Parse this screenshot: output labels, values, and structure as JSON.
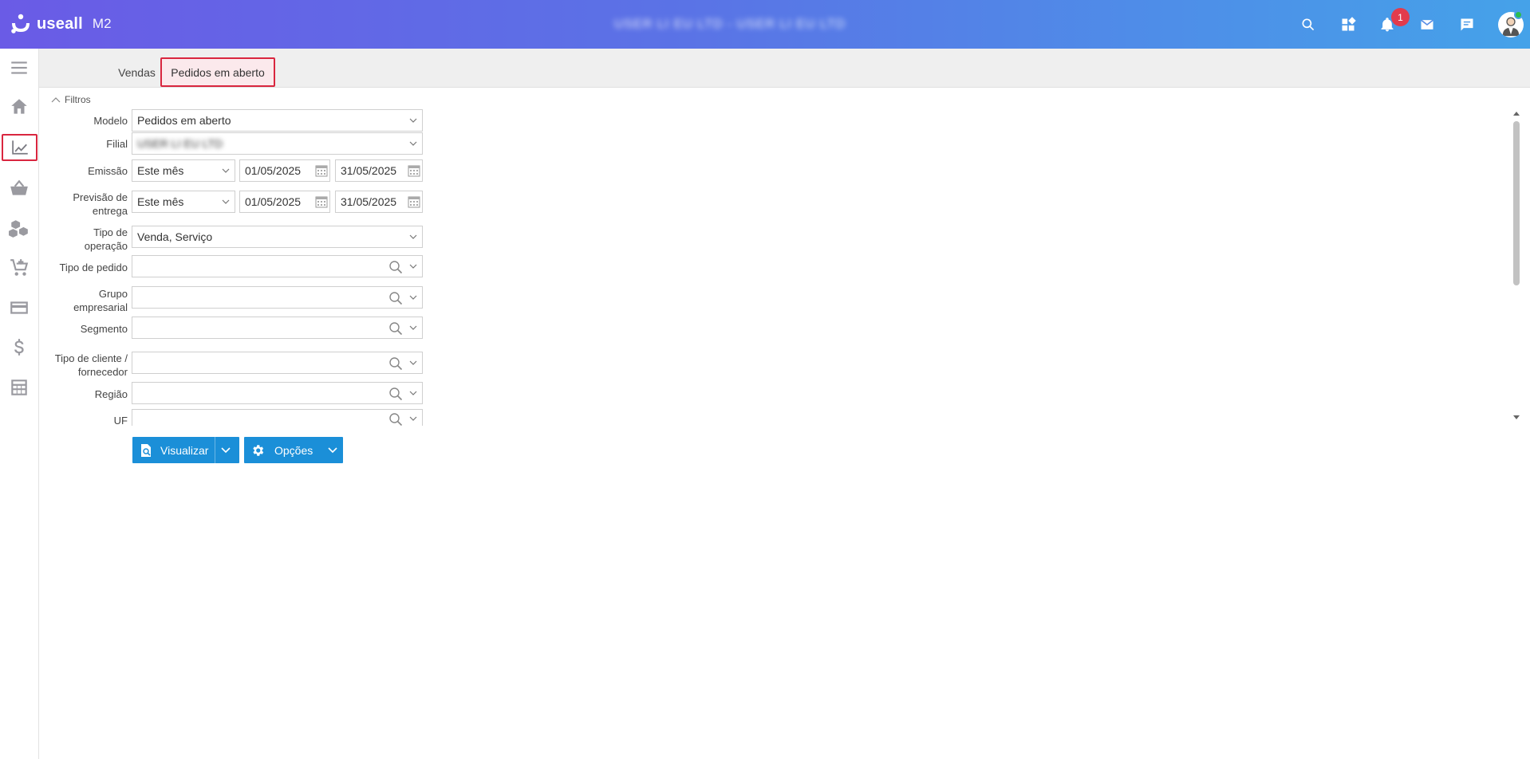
{
  "header": {
    "brand": "useall",
    "version": "M2",
    "company": "USER LI EU LTD - USER LI EU LTD",
    "notification_count": "1"
  },
  "header_icons": [
    "search-icon",
    "dashboard-icon",
    "bell-icon",
    "mail-icon",
    "chat-icon",
    "user-avatar"
  ],
  "sidebar": {
    "items": [
      "menu-icon",
      "home-icon",
      "chart-icon",
      "basket-icon",
      "boxes-icon",
      "cart-icon",
      "card-icon",
      "dollar-icon",
      "calculator-icon"
    ],
    "active": "chart-icon"
  },
  "tabs": [
    {
      "label": "Vendas"
    },
    {
      "label": "Pedidos em aberto"
    }
  ],
  "filters": {
    "title": "Filtros",
    "modelo": {
      "label": "Modelo",
      "value": "Pedidos em aberto"
    },
    "filial": {
      "label": "Filial",
      "value": "USER LI EU LTD"
    },
    "emissao": {
      "label": "Emissão",
      "period": "Este mês",
      "from": "01/05/2025",
      "to": "31/05/2025"
    },
    "previsao": {
      "label_1": "Previsão de",
      "label_2": "entrega",
      "period": "Este mês",
      "from": "01/05/2025",
      "to": "31/05/2025"
    },
    "tipo_operacao": {
      "label_1": "Tipo de",
      "label_2": "operação",
      "value": "Venda, Serviço"
    },
    "tipo_pedido": {
      "label": "Tipo de pedido",
      "value": ""
    },
    "grupo": {
      "label_1": "Grupo",
      "label_2": "empresarial",
      "value": ""
    },
    "segmento": {
      "label": "Segmento",
      "value": ""
    },
    "tipo_cliente": {
      "label_1": "Tipo de cliente /",
      "label_2": "fornecedor",
      "value": ""
    },
    "regiao": {
      "label": "Região",
      "value": ""
    },
    "uf": {
      "label": "UF",
      "value": ""
    }
  },
  "buttons": {
    "visualizar": "Visualizar",
    "opcoes": "Opções"
  },
  "colors": {
    "header_gradient_start": "#6a5be6",
    "header_gradient_end": "#45a2e9",
    "active_border": "#d9263f",
    "button_blue": "#1b8fd8",
    "badge_red": "#e23b4c"
  }
}
